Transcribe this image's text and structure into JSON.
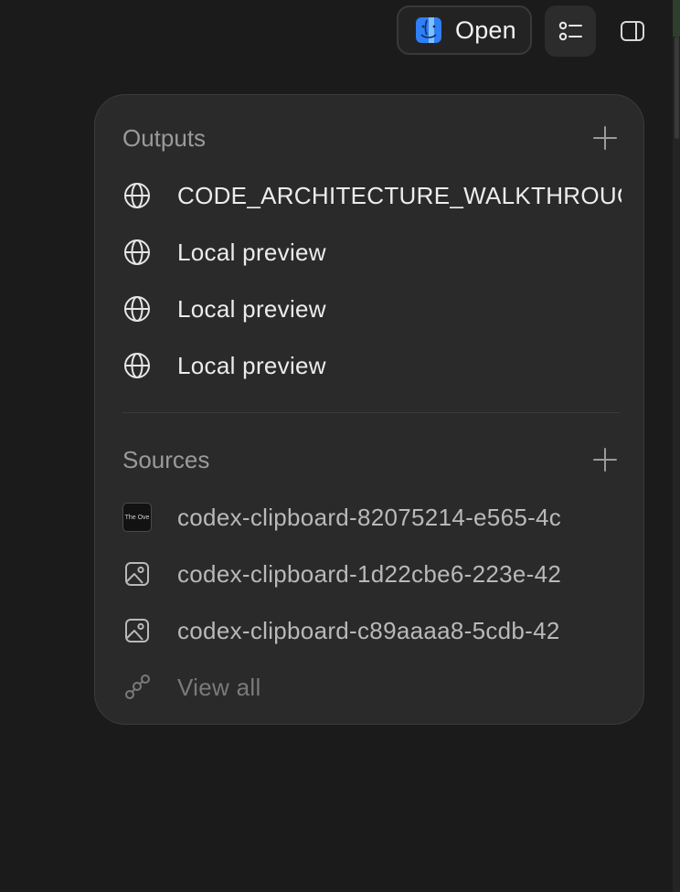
{
  "toolbar": {
    "open_label": "Open",
    "open_icon": "finder-icon",
    "list_icon": "list-toggle-icon",
    "panel_icon": "sidebar-panel-icon"
  },
  "outputs": {
    "title": "Outputs",
    "add_icon": "plus-icon",
    "items": [
      {
        "label": "CODE_ARCHITECTURE_WALKTHROUGH",
        "icon": "globe-icon"
      },
      {
        "label": "Local preview",
        "icon": "globe-icon"
      },
      {
        "label": "Local preview",
        "icon": "globe-icon"
      },
      {
        "label": "Local preview",
        "icon": "globe-icon"
      }
    ]
  },
  "sources": {
    "title": "Sources",
    "add_icon": "plus-icon",
    "items": [
      {
        "label": "codex-clipboard-82075214-e565-4c",
        "icon": "image-thumbnail",
        "thumb_text": "The Ove"
      },
      {
        "label": "codex-clipboard-1d22cbe6-223e-42",
        "icon": "image-icon"
      },
      {
        "label": "codex-clipboard-c89aaaa8-5cdb-42",
        "icon": "image-icon"
      }
    ],
    "view_all": {
      "label": "View all",
      "icon": "link-nodes-icon"
    }
  },
  "colors": {
    "background": "#1b1b1b",
    "card": "#2a2a2a",
    "accent_blue": "#2f7ff6",
    "muted_text": "#9a9a9a"
  }
}
